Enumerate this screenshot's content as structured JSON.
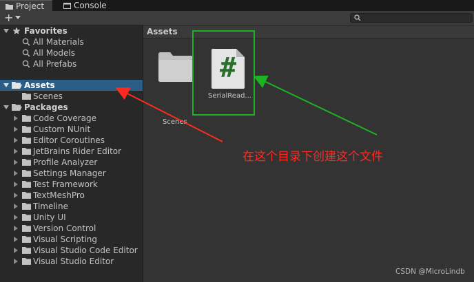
{
  "tabs": [
    {
      "label": "Project",
      "icon": "folder-icon",
      "active": true
    },
    {
      "label": "Console",
      "icon": "console-icon",
      "active": false
    }
  ],
  "toolbar": {
    "add_icon": "plus-icon",
    "search_icon": "search-icon"
  },
  "sidebar": {
    "favorites": {
      "label": "Favorites",
      "items": [
        "All Materials",
        "All Models",
        "All Prefabs"
      ]
    },
    "assets": {
      "label": "Assets",
      "selected": true,
      "children": [
        "Scenes"
      ]
    },
    "packages": {
      "label": "Packages",
      "items": [
        "Code Coverage",
        "Custom NUnit",
        "Editor Coroutines",
        "JetBrains Rider Editor",
        "Profile Analyzer",
        "Settings Manager",
        "Test Framework",
        "TextMeshPro",
        "Timeline",
        "Unity UI",
        "Version Control",
        "Visual Scripting",
        "Visual Studio Code Editor",
        "Visual Studio Editor"
      ]
    }
  },
  "main": {
    "breadcrumb": "Assets",
    "assets": [
      {
        "label": "Scenes",
        "type": "folder"
      },
      {
        "label": "SerialRead...",
        "type": "csharp-script",
        "glyph": "#"
      }
    ]
  },
  "annotation": {
    "text": "在这个目录下创建这个文件",
    "color": "#ff2a1f",
    "highlight_color": "#1db224"
  },
  "watermark": "CSDN @MicroLindb",
  "colors": {
    "selection": "#2c5d87",
    "script_hash": "#2b6e2e"
  }
}
